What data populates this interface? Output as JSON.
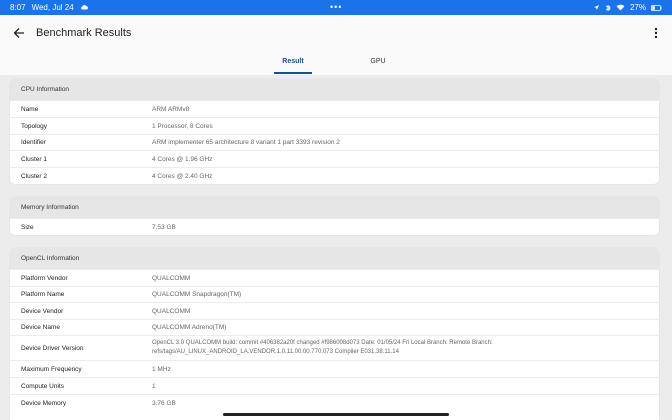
{
  "status": {
    "time": "8:07",
    "date": "Wed, Jul 24",
    "dots": "•••",
    "battery": "27%"
  },
  "header": {
    "title": "Benchmark Results"
  },
  "tabs": [
    {
      "label": "Result",
      "active": true
    },
    {
      "label": "GPU",
      "active": false
    }
  ],
  "sections": {
    "cpu": {
      "title": "CPU Information",
      "rows": [
        {
          "label": "Name",
          "value": "ARM ARMv8"
        },
        {
          "label": "Topology",
          "value": "1 Processor, 8 Cores"
        },
        {
          "label": "Identifier",
          "value": "ARM implementer 65 architecture 8 variant 1 part 3393 revision 2"
        },
        {
          "label": "Cluster 1",
          "value": "4 Cores @ 1.96 GHz"
        },
        {
          "label": "Cluster 2",
          "value": "4 Cores @ 2.40 GHz"
        }
      ]
    },
    "memory": {
      "title": "Memory Information",
      "rows": [
        {
          "label": "Size",
          "value": "7.53 GB"
        }
      ]
    },
    "opencl": {
      "title": "OpenCL Information",
      "rows": [
        {
          "label": "Platform Vendor",
          "value": "QUALCOMM"
        },
        {
          "label": "Platform Name",
          "value": "QUALCOMM Snapdragon(TM)"
        },
        {
          "label": "Device Vendor",
          "value": "QUALCOMM"
        },
        {
          "label": "Device Name",
          "value": "QUALCOMM Adreno(TM)"
        },
        {
          "label": "Device Driver Version",
          "value": "OpenCL 3.0 QUALCOMM build: commit #406382a20f changed #f986008d073 Date: 01/05/24 Fri Local Branch: Remote Branch: refs/tags/AU_LINUX_ANDROID_LA.VENDOR.1.0.11.00.00.770.073 Compiler E031.38.11.14"
        },
        {
          "label": "Maximum Frequency",
          "value": "1 MHz"
        },
        {
          "label": "Compute Units",
          "value": "1"
        },
        {
          "label": "Device Memory",
          "value": "3.76 GB"
        }
      ]
    }
  },
  "colors": {
    "status_bar": "#1a73e8",
    "accent": "#1a4f8f"
  }
}
